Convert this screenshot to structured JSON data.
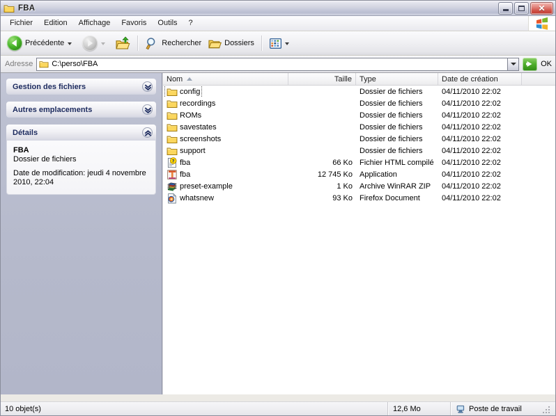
{
  "window": {
    "title": "FBA",
    "icon": "folder-icon",
    "controls": {
      "minimize": "Réduire",
      "maximize": "Agrandir",
      "close": "Fermer"
    }
  },
  "menubar": {
    "items": [
      {
        "label": "Fichier"
      },
      {
        "label": "Edition"
      },
      {
        "label": "Affichage"
      },
      {
        "label": "Favoris"
      },
      {
        "label": "Outils"
      },
      {
        "label": "?"
      }
    ],
    "logo": "windows-logo-icon"
  },
  "toolbar": {
    "back_label": "Précédente",
    "forward_label": "Suivante",
    "up_label": "Dossier parent",
    "search_label": "Rechercher",
    "folders_label": "Dossiers",
    "views_label": "Affichages"
  },
  "address": {
    "label": "Adresse",
    "value": "C:\\perso\\FBA",
    "placeholder": "C:\\perso\\FBA",
    "go_label": "OK"
  },
  "sidebar": {
    "panels": [
      {
        "title": "Gestion des fichiers",
        "state": "collapsed",
        "chevron": "chevron-down-icon"
      },
      {
        "title": "Autres emplacements",
        "state": "collapsed",
        "chevron": "chevron-down-icon"
      },
      {
        "title": "Détails",
        "state": "expanded",
        "chevron": "chevron-up-icon"
      }
    ],
    "details": {
      "name": "FBA",
      "kind": "Dossier de fichiers",
      "modified": "Date de modification: jeudi 4 novembre 2010, 22:04"
    }
  },
  "filelist": {
    "columns": [
      {
        "label": "Nom",
        "sorted": "asc"
      },
      {
        "label": "Taille"
      },
      {
        "label": "Type"
      },
      {
        "label": "Date de création"
      }
    ],
    "rows": [
      {
        "name": "config",
        "icon": "folder-icon",
        "size": "",
        "type": "Dossier de fichiers",
        "date": "04/11/2010 22:02",
        "focused": true
      },
      {
        "name": "recordings",
        "icon": "folder-icon",
        "size": "",
        "type": "Dossier de fichiers",
        "date": "04/11/2010 22:02"
      },
      {
        "name": "ROMs",
        "icon": "folder-icon",
        "size": "",
        "type": "Dossier de fichiers",
        "date": "04/11/2010 22:02"
      },
      {
        "name": "savestates",
        "icon": "folder-icon",
        "size": "",
        "type": "Dossier de fichiers",
        "date": "04/11/2010 22:02"
      },
      {
        "name": "screenshots",
        "icon": "folder-icon",
        "size": "",
        "type": "Dossier de fichiers",
        "date": "04/11/2010 22:02"
      },
      {
        "name": "support",
        "icon": "folder-icon",
        "size": "",
        "type": "Dossier de fichiers",
        "date": "04/11/2010 22:02"
      },
      {
        "name": "fba",
        "icon": "chm-help-icon",
        "size": "66 Ko",
        "type": "Fichier HTML compilé",
        "date": "04/11/2010 22:02"
      },
      {
        "name": "fba",
        "icon": "application-icon",
        "size": "12 745 Ko",
        "type": "Application",
        "date": "04/11/2010 22:02"
      },
      {
        "name": "preset-example",
        "icon": "winrar-zip-icon",
        "size": "1 Ko",
        "type": "Archive WinRAR ZIP",
        "date": "04/11/2010 22:02"
      },
      {
        "name": "whatsnew",
        "icon": "firefox-document-icon",
        "size": "93 Ko",
        "type": "Firefox Document",
        "date": "04/11/2010 22:02"
      }
    ]
  },
  "statusbar": {
    "objects": "10 objet(s)",
    "size": "12,6 Mo",
    "location": "Poste de travail",
    "location_icon": "computer-icon"
  },
  "colors": {
    "titlebar_text": "#232323",
    "panel_title": "#1c2a5e",
    "sidebar_bg": "#b5b9cb",
    "folder_yellow": "#f8d77a",
    "accent_green": "#4fae2c"
  }
}
